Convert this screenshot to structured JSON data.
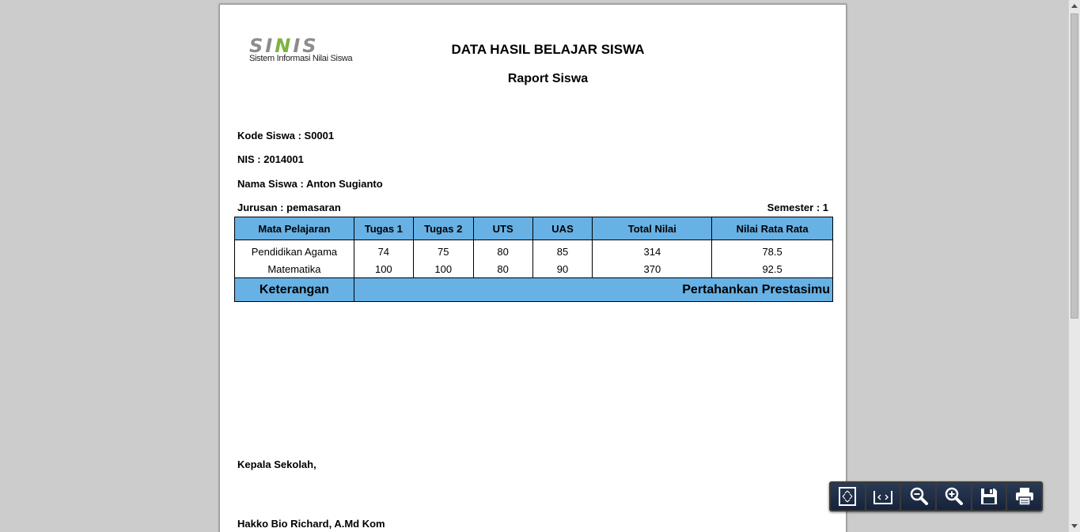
{
  "logo": {
    "word_left": "SI",
    "word_mid": "N",
    "word_right": "IS",
    "tagline": "Sistem Informasi Nilai Siswa"
  },
  "header": {
    "title": "DATA HASIL BELAJAR SISWA",
    "subtitle": "Raport Siswa"
  },
  "student": {
    "kode": "Kode Siswa : S0001",
    "nis": "NIS : 2014001",
    "nama": "Nama Siswa : Anton Sugianto",
    "jurusan": "Jurusan : pemasaran",
    "semester": "Semester : 1"
  },
  "table": {
    "headers": [
      "Mata Pelajaran",
      "Tugas 1",
      "Tugas 2",
      "UTS",
      "UAS",
      "Total Nilai",
      "Nilai Rata Rata"
    ],
    "rows": [
      [
        "Pendidikan Agama",
        "74",
        "75",
        "80",
        "85",
        "314",
        "78.5"
      ],
      [
        "Matematika",
        "100",
        "100",
        "80",
        "90",
        "370",
        "92.5"
      ]
    ],
    "footer_label": "Keterangan",
    "footer_value": "Pertahankan Prestasimu"
  },
  "signature": {
    "label": "Kepala Sekolah,",
    "name": "Hakko Bio Richard, A.Md Kom"
  },
  "toolbar": {
    "icons": [
      "fit-page-icon",
      "fit-width-icon",
      "zoom-out-icon",
      "zoom-in-icon",
      "save-icon",
      "print-icon"
    ]
  },
  "colors": {
    "table_header": "#67b1e4",
    "toolbar_bg": "#16223a",
    "logo_green": "#7cb342"
  }
}
